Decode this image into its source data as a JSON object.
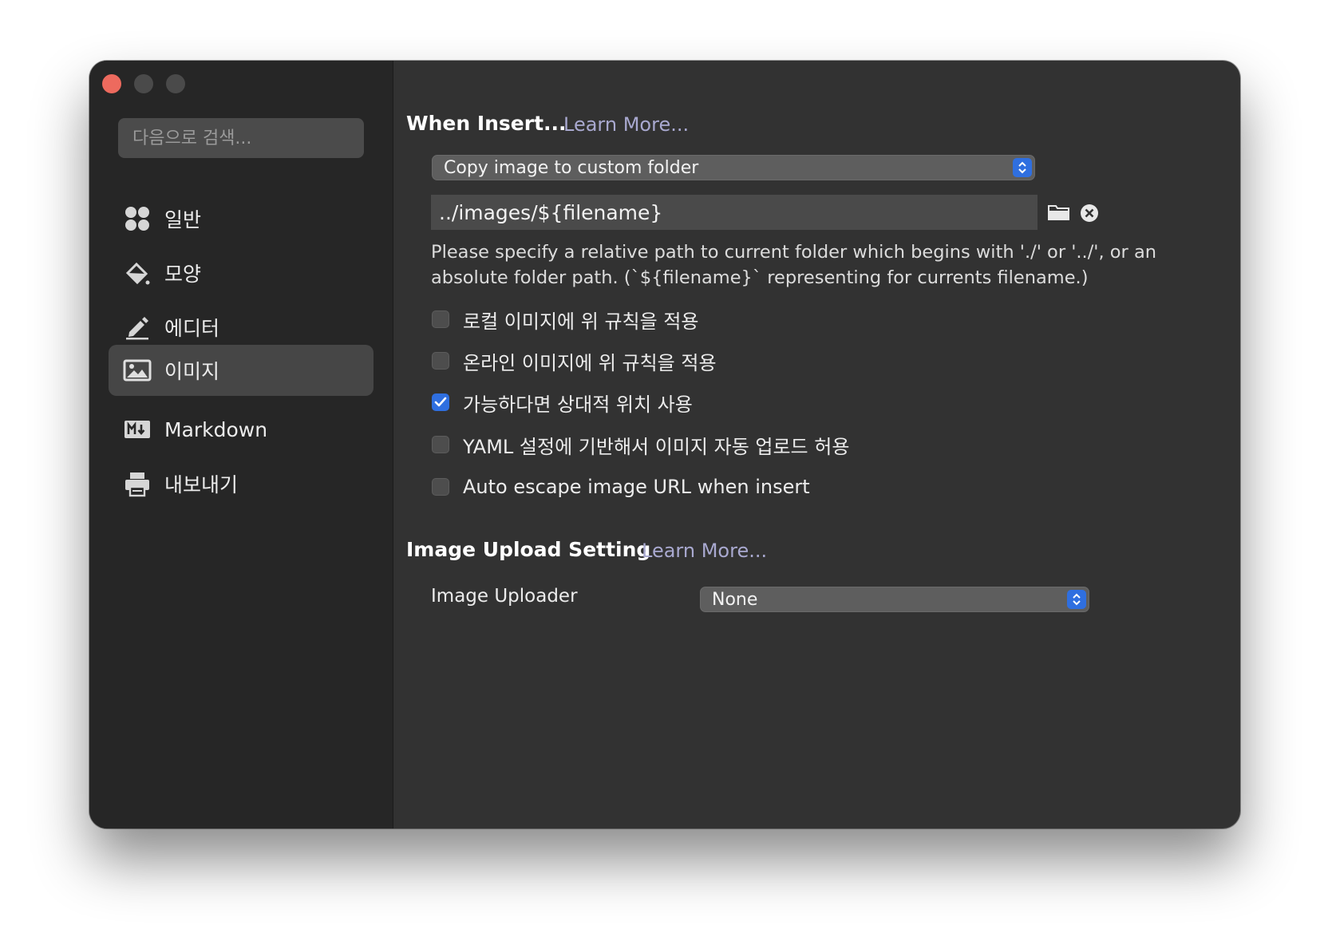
{
  "search": {
    "placeholder": "다음으로 검색..."
  },
  "sidebar": {
    "items": [
      {
        "label": "일반",
        "icon": "grid-circles-icon"
      },
      {
        "label": "모양",
        "icon": "paint-bucket-icon"
      },
      {
        "label": "에디터",
        "icon": "pencil-icon"
      },
      {
        "label": "이미지",
        "icon": "image-icon",
        "active": true
      },
      {
        "label": "Markdown",
        "icon": "markdown-icon"
      },
      {
        "label": "내보내기",
        "icon": "printer-icon"
      }
    ]
  },
  "insert": {
    "title": "When Insert...",
    "learn_more": "Learn More...",
    "action_select": "Copy image to custom folder",
    "path_value": "../images/${filename}",
    "help_text": " Please specify a relative path to current folder which begins with './' or '../', or an absolute folder path. (`${filename}` representing for currents filename.)",
    "options": [
      {
        "label": "로컬 이미지에 위 규칙을 적용",
        "checked": false
      },
      {
        "label": "온라인 이미지에 위 규칙을 적용",
        "checked": false
      },
      {
        "label": "가능하다면 상대적 위치 사용",
        "checked": true
      },
      {
        "label": "YAML 설정에 기반해서 이미지 자동 업로드 허용",
        "checked": false
      },
      {
        "label": "Auto escape image URL when insert",
        "checked": false
      }
    ],
    "help_button": "?"
  },
  "upload": {
    "title": "Image Upload Setting",
    "learn_more": "Learn More...",
    "uploader_label": "Image Uploader",
    "uploader_value": "None"
  },
  "colors": {
    "accent": "#2f6fe0",
    "window_bg": "#323232",
    "sidebar_bg": "#262626",
    "link": "#a9a9d0"
  }
}
